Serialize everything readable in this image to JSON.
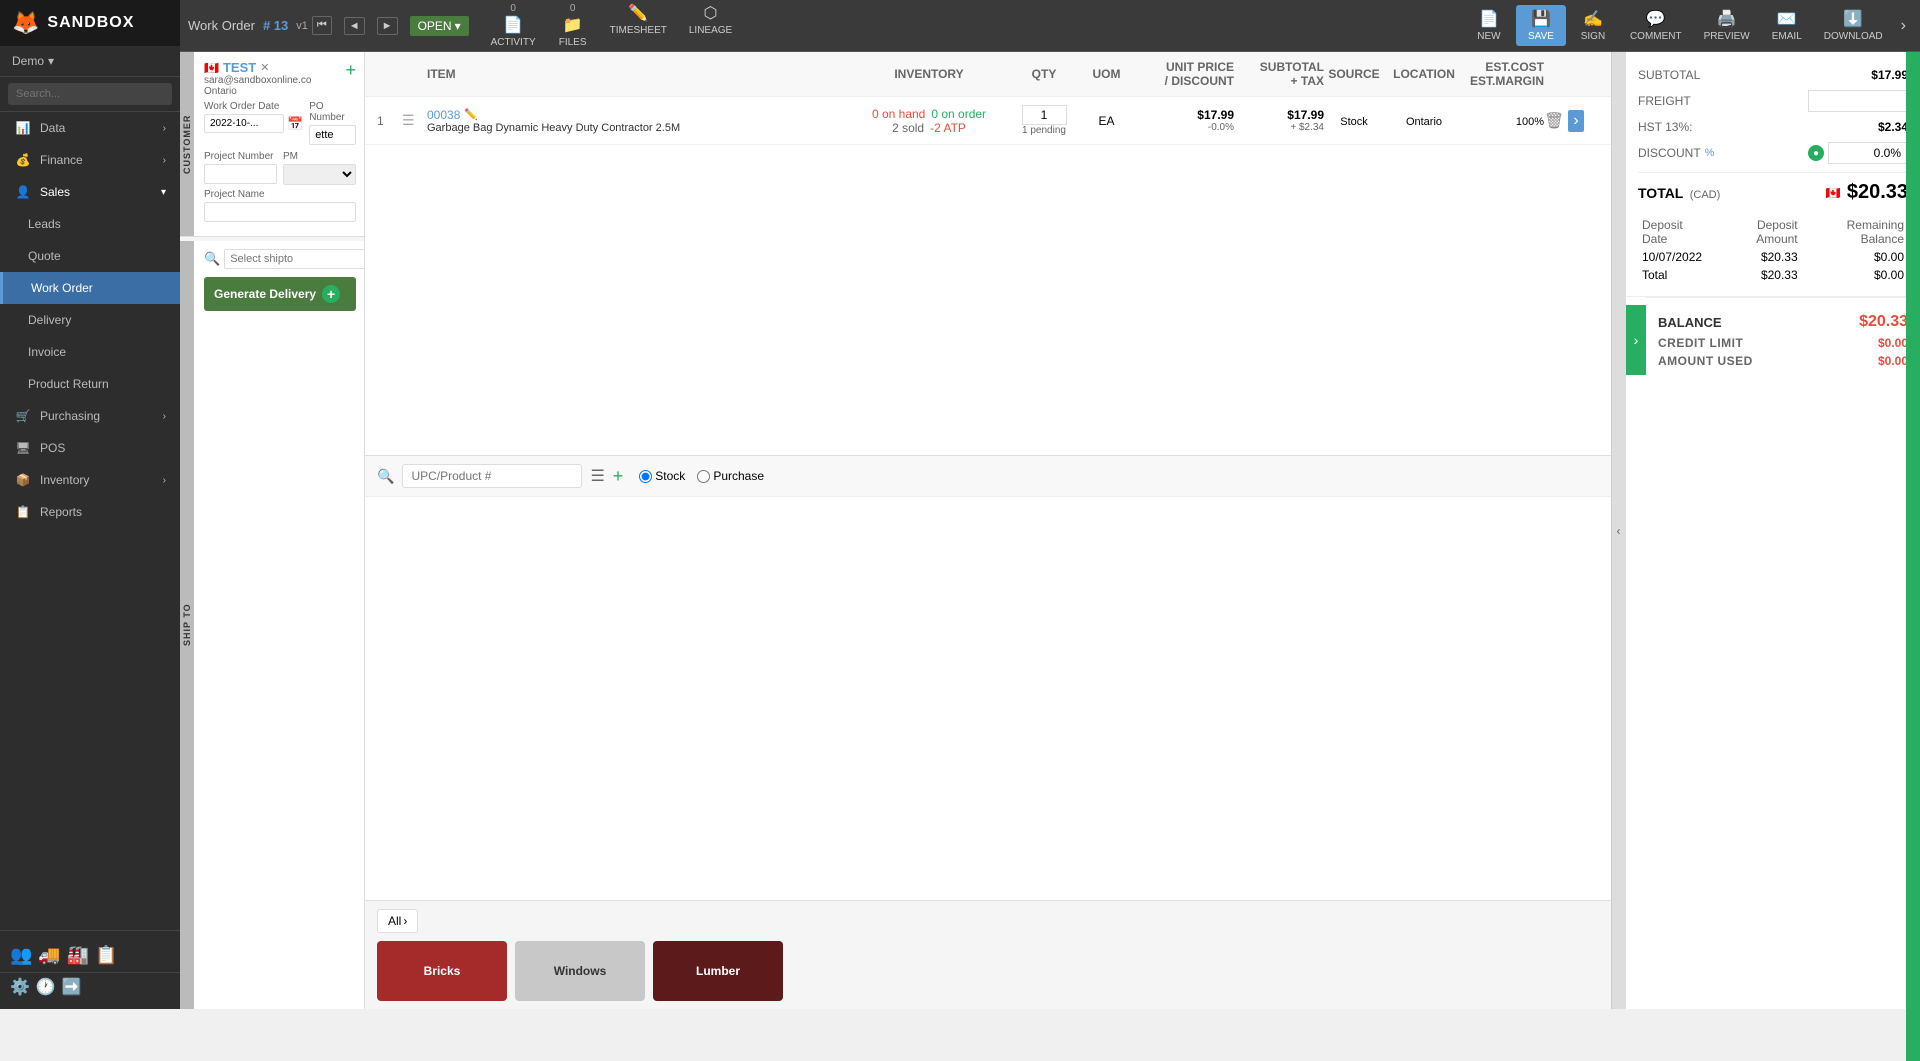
{
  "app": {
    "name": "SANDBOX",
    "logo_icon": "🦊"
  },
  "demo": {
    "label": "Demo",
    "dropdown_icon": "▾"
  },
  "search": {
    "placeholder": "Search..."
  },
  "sidebar": {
    "items": [
      {
        "id": "data",
        "label": "Data",
        "icon": "📊",
        "has_arrow": true
      },
      {
        "id": "finance",
        "label": "Finance",
        "icon": "💰",
        "has_arrow": true
      },
      {
        "id": "sales",
        "label": "Sales",
        "icon": "👤",
        "has_arrow": true
      },
      {
        "id": "leads",
        "label": "Leads",
        "icon": "",
        "is_child": true
      },
      {
        "id": "quote",
        "label": "Quote",
        "icon": "",
        "is_child": true
      },
      {
        "id": "work-order",
        "label": "Work Order",
        "icon": "",
        "is_child": true,
        "is_active": true
      },
      {
        "id": "delivery",
        "label": "Delivery",
        "icon": "",
        "is_child": true
      },
      {
        "id": "invoice",
        "label": "Invoice",
        "icon": "",
        "is_child": true
      },
      {
        "id": "product-return",
        "label": "Product Return",
        "icon": "",
        "is_child": true
      },
      {
        "id": "purchasing",
        "label": "Purchasing",
        "icon": "🛒",
        "has_arrow": true
      },
      {
        "id": "pos",
        "label": "POS",
        "icon": "🖥",
        "has_arrow": false
      },
      {
        "id": "inventory",
        "label": "Inventory",
        "icon": "📦",
        "has_arrow": true
      },
      {
        "id": "reports",
        "label": "Reports",
        "icon": "📋",
        "has_arrow": false
      }
    ],
    "bottom_icons": [
      "👥",
      "🚚",
      "🏭",
      "📋"
    ],
    "settings_icons": [
      "⚙️",
      "🕐",
      "➡️"
    ]
  },
  "topbar": {
    "section": "Work Order",
    "number": "# 13",
    "version": "v1",
    "status": "OPEN",
    "nav_prev_prev": "⏮",
    "nav_prev": "◄",
    "nav_next": "►",
    "actions": [
      {
        "id": "activity",
        "label": "ACTIVITY",
        "icon": "📄",
        "badge": "0"
      },
      {
        "id": "files",
        "label": "FILES",
        "icon": "📁",
        "badge": "0"
      },
      {
        "id": "timesheet",
        "label": "TIMESHEET",
        "icon": "✏️"
      },
      {
        "id": "lineage",
        "label": "LINEAGE",
        "icon": "⬡"
      }
    ],
    "right_actions": [
      {
        "id": "new",
        "label": "NEW",
        "icon": "📄"
      },
      {
        "id": "save",
        "label": "SAVE",
        "icon": "💾",
        "is_active": true
      },
      {
        "id": "sign",
        "label": "SIGN",
        "icon": "✍️"
      },
      {
        "id": "comment",
        "label": "COMMENT",
        "icon": "💬"
      },
      {
        "id": "preview",
        "label": "PREVIEW",
        "icon": "🖨️"
      },
      {
        "id": "email",
        "label": "EMAIL",
        "icon": "✉️"
      },
      {
        "id": "download",
        "label": "DOWNLOAD",
        "icon": "⬇️"
      }
    ]
  },
  "customer": {
    "name": "TEST",
    "email": "sara@sandboxonline.co",
    "location": "Ontario",
    "flag": "🇨🇦",
    "clear_icon": "✕"
  },
  "form": {
    "work_order_date_label": "Work Order Date",
    "work_order_date": "2022-10-...",
    "po_number_label": "PO Number",
    "po_number": "ette",
    "project_number_label": "Project Number",
    "project_number": "",
    "pm_label": "PM",
    "pm_value": "",
    "project_name_label": "Project Name",
    "project_name": ""
  },
  "shipto": {
    "search_placeholder": "Select shipto",
    "generate_btn": "Generate Delivery",
    "add_icon": "+"
  },
  "items": {
    "columns": [
      "",
      "",
      "ITEM",
      "INVENTORY",
      "QTY",
      "UOM",
      "UNIT PRICE / DISCOUNT",
      "SUBTOTAL + TAX",
      "SOURCE",
      "LOCATION",
      "EST.COST EST.MARGIN",
      ""
    ],
    "rows": [
      {
        "num": "1",
        "id": "00038",
        "name": "Garbage Bag Dynamic Heavy Duty Contractor 2.5M",
        "on_hand": "0 on hand",
        "on_order": "0 on order",
        "sold": "2 sold",
        "atp": "-2 ATP",
        "qty": "1",
        "pending": "1 pending",
        "uom": "EA",
        "unit_price": "$17.99",
        "discount": "-0.0%",
        "subtotal": "$17.99",
        "tax": "+ $2.34",
        "source": "Stock",
        "location": "Ontario",
        "est_cost": "100%"
      }
    ]
  },
  "search_bar": {
    "placeholder": "UPC/Product #",
    "radio_stock": "Stock",
    "radio_purchase": "Purchase",
    "stock_selected": true
  },
  "categories": {
    "all_label": "All",
    "cards": [
      {
        "id": "bricks",
        "label": "Bricks",
        "color": "#a52a2a"
      },
      {
        "id": "windows",
        "label": "Windows",
        "color": "#c8c8c8",
        "text_color": "#333"
      },
      {
        "id": "lumber",
        "label": "Lumber",
        "color": "#5c1a1a"
      }
    ]
  },
  "totals": {
    "subtotal_label": "SUBTOTAL",
    "subtotal_value": "$17.99",
    "freight_label": "FREIGHT",
    "freight_value": "",
    "hst_label": "HST 13%:",
    "hst_value": "$2.34",
    "discount_label": "DISCOUNT",
    "discount_pct_label": "%",
    "discount_value": "0.0%",
    "total_label": "TOTAL",
    "total_cad": "(CAD)",
    "total_value": "$20.33",
    "deposit_columns": [
      "Deposit Date",
      "Deposit Amount",
      "Remaining Balance"
    ],
    "deposit_rows": [
      {
        "date": "10/07/2022",
        "amount": "$20.33",
        "balance": "$0.00"
      },
      {
        "date": "Total",
        "amount": "$20.33",
        "balance": "$0.00"
      }
    ],
    "balance_label": "BALANCE",
    "balance_value": "$20.33",
    "credit_limit_label": "CREDIT LIMIT",
    "credit_limit_value": "$0.00",
    "amount_used_label": "AMOUNT USED",
    "amount_used_value": "$0.00"
  }
}
